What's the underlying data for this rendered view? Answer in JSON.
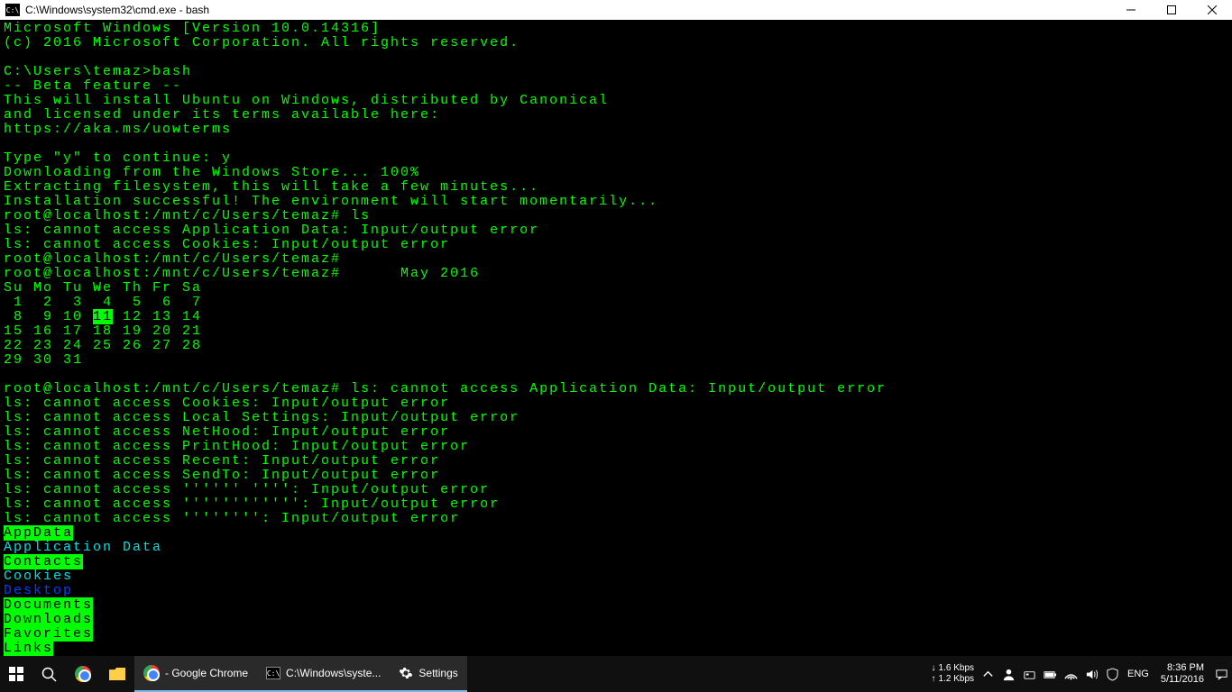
{
  "window": {
    "icon_text": "C:\\",
    "title": "C:\\Windows\\system32\\cmd.exe - bash"
  },
  "terminal": {
    "lines": [
      {
        "t": "Microsoft Windows [Version 10.0.14316]"
      },
      {
        "t": "(c) 2016 Microsoft Corporation. All rights reserved."
      },
      {
        "t": ""
      },
      {
        "t": "C:\\Users\\temaz>bash"
      },
      {
        "t": "-- Beta feature --"
      },
      {
        "t": "This will install Ubuntu on Windows, distributed by Canonical"
      },
      {
        "t": "and licensed under its terms available here:"
      },
      {
        "t": "https://aka.ms/uowterms"
      },
      {
        "t": ""
      },
      {
        "t": "Type \"y\" to continue: y"
      },
      {
        "t": "Downloading from the Windows Store... 100%"
      },
      {
        "t": "Extracting filesystem, this will take a few minutes..."
      },
      {
        "t": "Installation successful! The environment will start momentarily..."
      },
      {
        "t": "root@localhost:/mnt/c/Users/temaz# ls"
      },
      {
        "t": "ls: cannot access Application Data: Input/output error"
      },
      {
        "t": "ls: cannot access Cookies: Input/output error"
      },
      {
        "t": "root@localhost:/mnt/c/Users/temaz#"
      },
      {
        "t": "root@localhost:/mnt/c/Users/temaz#      May 2016"
      },
      {
        "t": "Su Mo Tu We Th Fr Sa"
      },
      {
        "segments": [
          {
            "t": " 1  2  3  4  5  6  7"
          }
        ]
      },
      {
        "segments": [
          {
            "t": " 8  9 10 "
          },
          {
            "t": "11",
            "c": "hl"
          },
          {
            "t": " 12 13 14"
          }
        ]
      },
      {
        "t": "15 16 17 18 19 20 21"
      },
      {
        "t": "22 23 24 25 26 27 28"
      },
      {
        "t": "29 30 31"
      },
      {
        "t": ""
      },
      {
        "t": "root@localhost:/mnt/c/Users/temaz# ls: cannot access Application Data: Input/output error"
      },
      {
        "t": "ls: cannot access Cookies: Input/output error"
      },
      {
        "t": "ls: cannot access Local Settings: Input/output error"
      },
      {
        "t": "ls: cannot access NetHood: Input/output error"
      },
      {
        "t": "ls: cannot access PrintHood: Input/output error"
      },
      {
        "t": "ls: cannot access Recent: Input/output error"
      },
      {
        "t": "ls: cannot access SendTo: Input/output error"
      },
      {
        "t": "ls: cannot access '''''' '''': Input/output error"
      },
      {
        "t": "ls: cannot access '''''''''''': Input/output error"
      },
      {
        "t": "ls: cannot access '''''''': Input/output error"
      },
      {
        "segments": [
          {
            "t": "AppData",
            "c": "blue hl"
          }
        ]
      },
      {
        "segments": [
          {
            "t": "Application Data",
            "c": "cyan"
          }
        ]
      },
      {
        "segments": [
          {
            "t": "Contacts",
            "c": "blue hl"
          }
        ]
      },
      {
        "segments": [
          {
            "t": "Cookies",
            "c": "cyan"
          }
        ]
      },
      {
        "segments": [
          {
            "t": "Desktop",
            "c": "blue"
          }
        ]
      },
      {
        "segments": [
          {
            "t": "Documents",
            "c": "blue hl"
          }
        ]
      },
      {
        "segments": [
          {
            "t": "Downloads",
            "c": "blue hl"
          }
        ]
      },
      {
        "segments": [
          {
            "t": "Favorites",
            "c": "blue hl"
          }
        ]
      },
      {
        "segments": [
          {
            "t": "Links",
            "c": "blue hl"
          }
        ]
      }
    ]
  },
  "taskbar": {
    "items": [
      {
        "label": "- Google Chrome"
      },
      {
        "label": "C:\\Windows\\syste..."
      },
      {
        "label": "Settings"
      }
    ],
    "net_down": "1.6 Kbps",
    "net_up": "1.2 Kbps",
    "lang": "ENG",
    "time": "8:36 PM",
    "date": "5/11/2016"
  }
}
